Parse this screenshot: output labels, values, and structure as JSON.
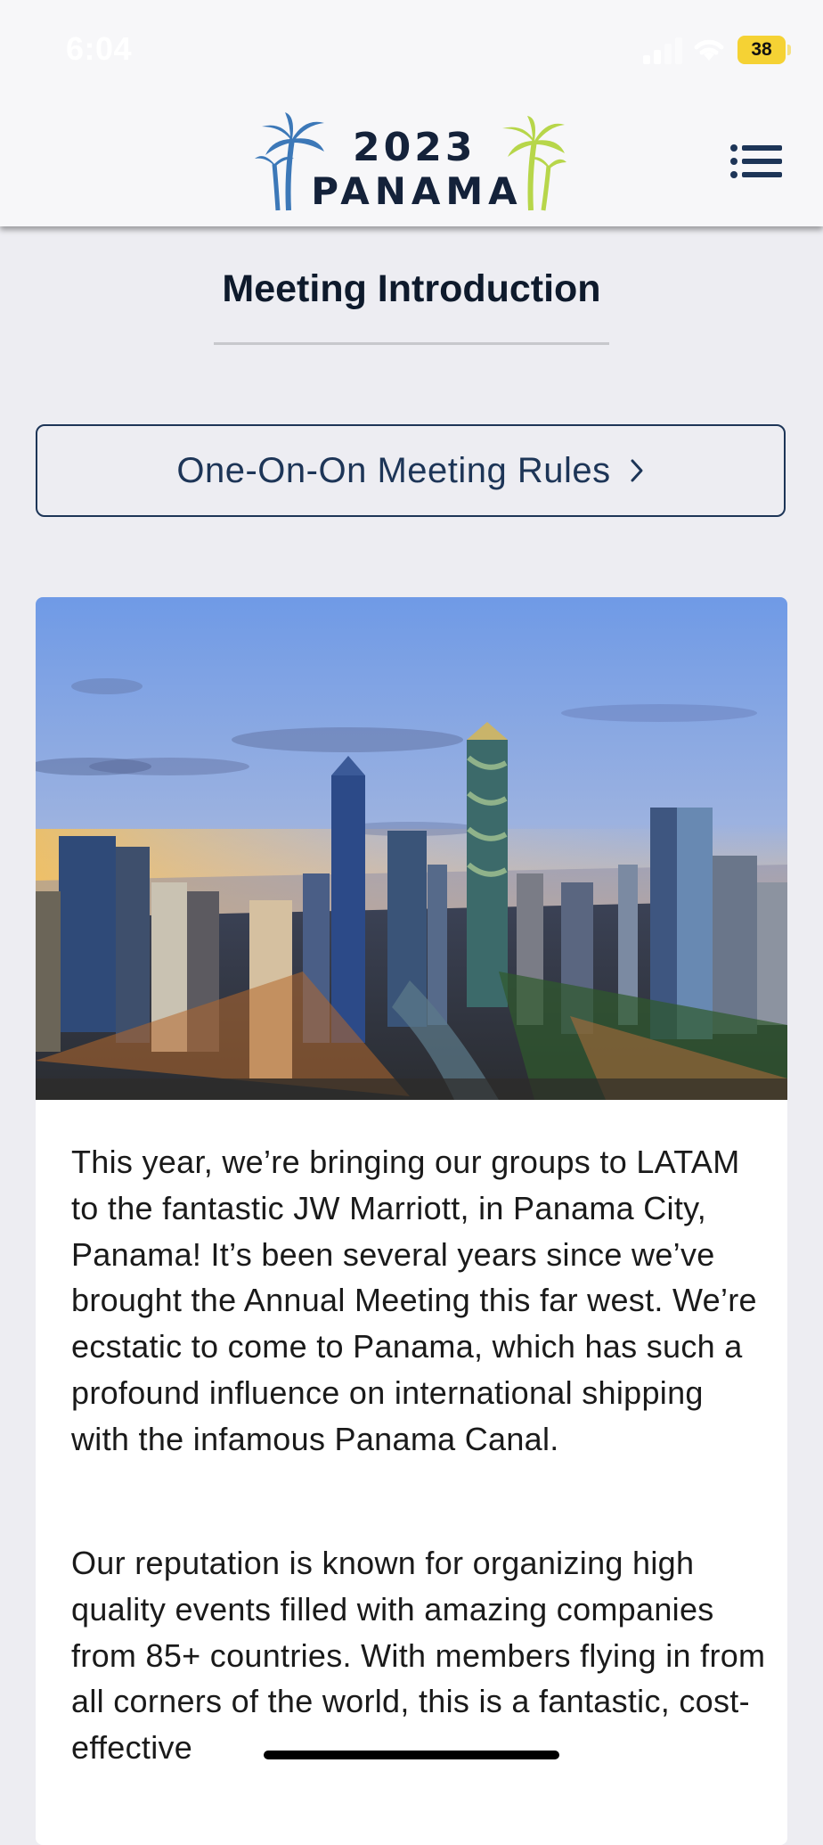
{
  "status_bar": {
    "time": "6:04",
    "battery": "38"
  },
  "header": {
    "logo_year": "2023",
    "logo_country": "PANAMA"
  },
  "page": {
    "title": "Meeting Introduction"
  },
  "rules_link": {
    "label": "One-On-On Meeting Rules"
  },
  "content": {
    "paragraphs": [
      "This year, we’re bringing our groups to LATAM to the fantastic JW Marriott, in Panama City, Panama! It’s been several years since we’ve brought the Annual Meeting this far west. We’re ecstatic to come to Panama, which has such a profound influence on international shipping with the infamous Panama Canal.",
      "Our reputation is known for organizing high quality events filled with amazing companies from 85+ countries. With members flying in from all corners of the world, this is a fantastic, cost-effective"
    ]
  },
  "icons": {
    "signal": "signal-icon",
    "wifi": "wifi-icon",
    "menu": "menu-icon",
    "chevron": "chevron-right-icon",
    "palm": "palm-tree-icon"
  },
  "colors": {
    "navy": "#1d3557",
    "logo_blue": "#3c78b8",
    "logo_green": "#b7d64a",
    "battery": "#f5d234"
  }
}
